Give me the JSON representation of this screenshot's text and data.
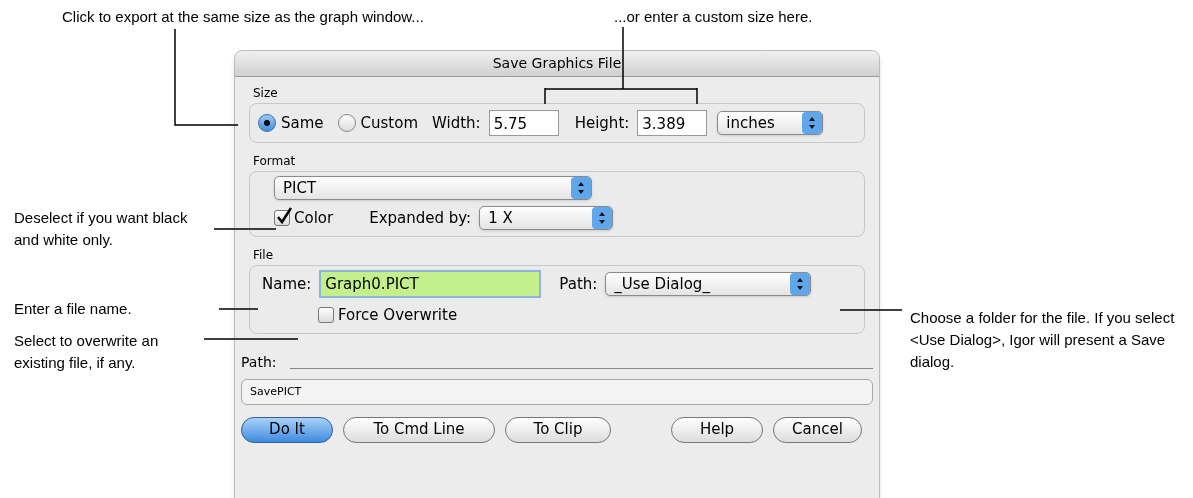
{
  "annotations": [
    {
      "text": "Click to export at the same size as the graph window..."
    },
    {
      "text": "...or enter a custom size here."
    },
    {
      "text": "Deselect if you want black and white only."
    },
    {
      "text": "Enter a file name."
    },
    {
      "text": "Select to overwrite an existing file, if any."
    },
    {
      "text": "Choose a folder for the file. If you select <Use Dialog>, Igor will present a Save dialog."
    }
  ],
  "dialog": {
    "title": "Save Graphics File",
    "size": {
      "label": "Size",
      "options": [
        {
          "label": "Same",
          "selected": true
        },
        {
          "label": "Custom",
          "selected": false
        }
      ],
      "width_label": "Width:",
      "width_value": "5.75",
      "height_label": "Height:",
      "height_value": "3.389",
      "units": "inches"
    },
    "format": {
      "label": "Format",
      "format_value": "PICT",
      "color": {
        "label": "Color",
        "checked": true
      },
      "expanded_label": "Expanded by:",
      "expanded_value": "1 X"
    },
    "file": {
      "label": "File",
      "name_label": "Name:",
      "name_value": "Graph0.PICT",
      "path_label": "Path:",
      "path_value": "_Use Dialog_",
      "force_overwrite": {
        "label": "Force Overwrite",
        "checked": false
      }
    },
    "path_label": "Path:",
    "command": "SavePICT",
    "buttons": [
      {
        "label": "Do It",
        "default": true
      },
      {
        "label": "To Cmd Line",
        "default": false
      },
      {
        "label": "To Clip",
        "default": false
      },
      {
        "label": "Help",
        "default": false
      },
      {
        "label": "Cancel",
        "default": false
      }
    ]
  }
}
